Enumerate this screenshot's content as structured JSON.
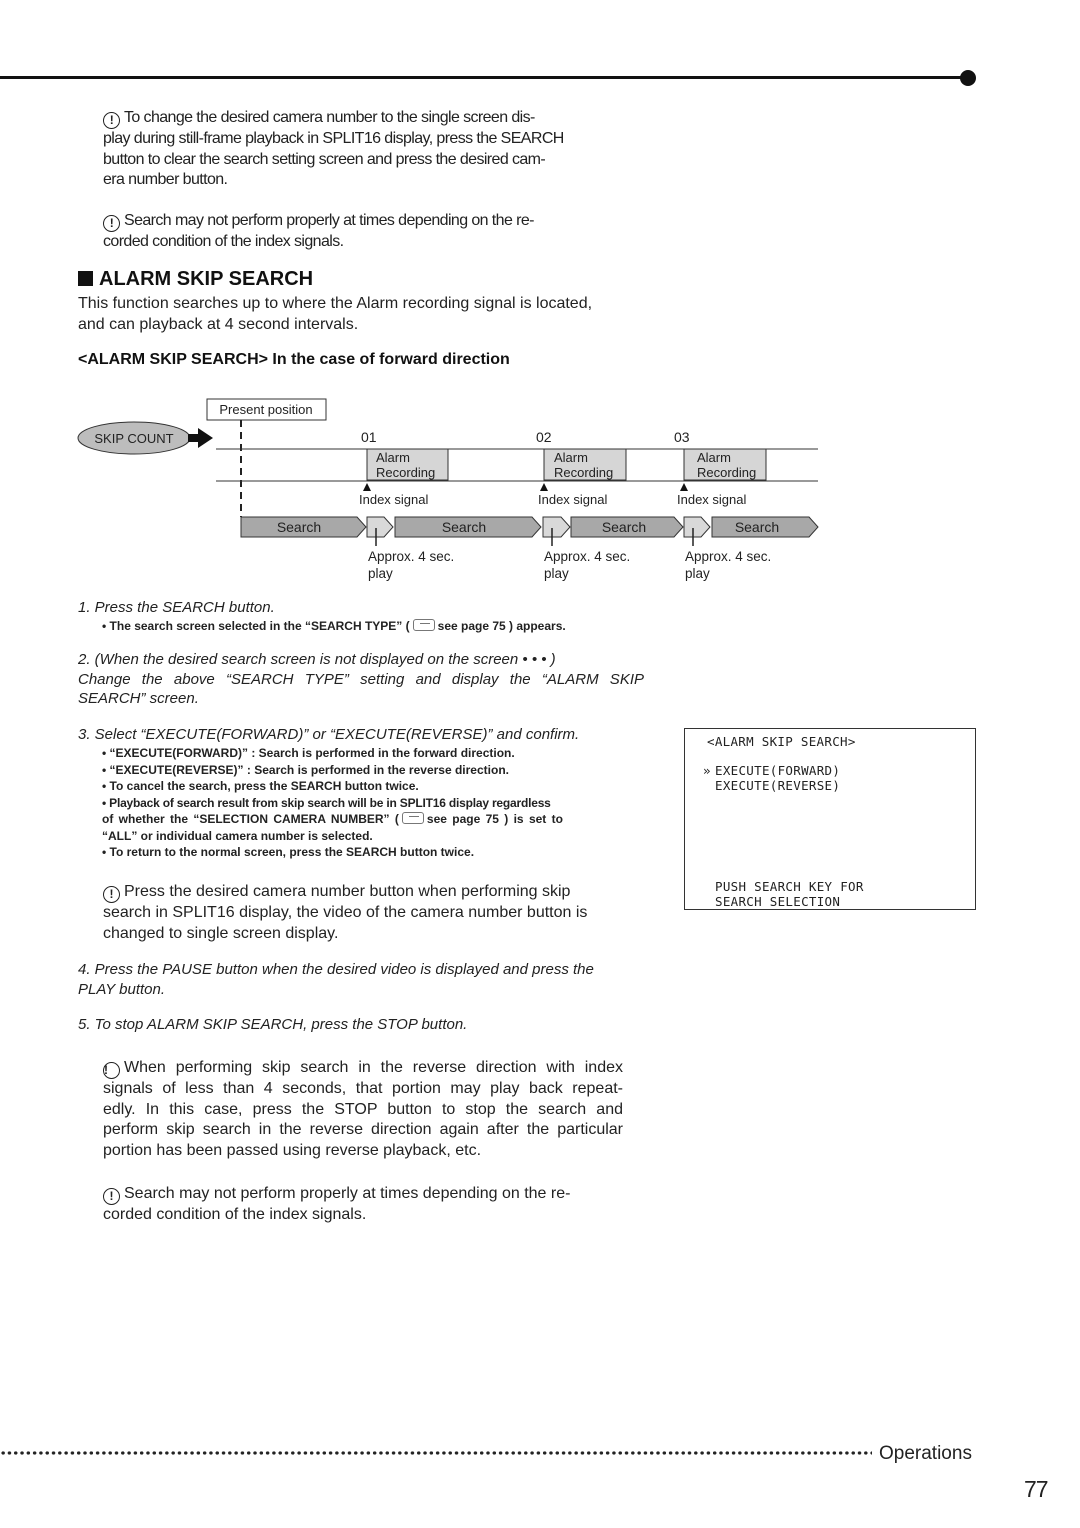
{
  "notes_top": [
    "To change the desired camera number to the single screen dis-",
    "play during still-frame playback in SPLIT16 display, press the SEARCH",
    "button to clear the search setting screen and press the desired cam-",
    "era number button."
  ],
  "note_search_1": [
    "Search may not perform properly at times depending on the re-",
    "corded condition of the index signals."
  ],
  "section": {
    "title": "ALARM SKIP SEARCH",
    "intro": [
      "This function searches up to where the Alarm recording signal is located,",
      "and can playback at 4 second intervals."
    ],
    "subtitle": "<ALARM SKIP SEARCH> In the case of forward direction"
  },
  "diagram": {
    "present_position": "Present position",
    "skip_count": "SKIP COUNT",
    "counts": [
      "01",
      "02",
      "03"
    ],
    "alarm_line1": "Alarm",
    "alarm_line2": "Recording",
    "index_signal": "Index signal",
    "search_label": "Search",
    "approx_line1": "Approx. 4 sec.",
    "approx_line2": "play"
  },
  "steps": {
    "s1": "1. Press the SEARCH button.",
    "s1_bullet_pre": "• The search screen selected in the “SEARCH TYPE” (",
    "s1_bullet_post": "see page 75 ) appears.",
    "s2": [
      "2. (When the desired search screen is not displayed on the screen • • • )",
      "Change the above “SEARCH TYPE” setting and display the “ALARM SKIP",
      "SEARCH” screen."
    ],
    "s3": "3. Select “EXECUTE(FORWARD)” or “EXECUTE(REVERSE)” and confirm.",
    "s3_bullets": [
      "• “EXECUTE(FORWARD)” : Search is performed in the forward direction.",
      "• “EXECUTE(REVERSE)” : Search is performed in the reverse direction.",
      "• To cancel the search, press the SEARCH button twice.",
      "• Playback of search result from skip search will be in SPLIT16 display regardless"
    ],
    "s3_bullet_ref_pre": "of whether the “SELECTION CAMERA NUMBER” (",
    "s3_bullet_ref_post": "see page 75 ) is set to",
    "s3_bullet_tail": "“ALL” or individual camera number is selected.",
    "s3_bullet_last": "• To return to the normal screen, press the SEARCH button twice.",
    "note_camera": [
      "Press the desired camera number button when performing skip",
      "search in SPLIT16 display, the video of the camera number button is",
      "changed to single screen display."
    ],
    "s4": [
      "4. Press the PAUSE button when the desired video is displayed and press the",
      "PLAY button."
    ],
    "s5": "5. To stop ALARM SKIP SEARCH, press the STOP button.",
    "note_reverse": [
      "When performing skip search in the reverse direction with index",
      "signals of less than 4 seconds, that portion may play back repeat-",
      "edly. In this case, press the STOP button to stop the search and",
      "perform skip search in the reverse direction again after the particular",
      "portion has been passed using reverse playback, etc."
    ],
    "note_search_2": [
      "Search may not perform properly at times depending on the re-",
      "corded condition of the index signals."
    ]
  },
  "osd": {
    "title": "<ALARM SKIP SEARCH>",
    "cursor": "»",
    "option_forward": "EXECUTE(FORWARD)",
    "option_reverse": "EXECUTE(REVERSE)",
    "hint_line1": "PUSH SEARCH KEY FOR",
    "hint_line2": "SEARCH SELECTION"
  },
  "footer": {
    "section": "Operations",
    "page_number": "77"
  },
  "icons": {
    "warning": "!",
    "reference": "pointing-hand"
  }
}
